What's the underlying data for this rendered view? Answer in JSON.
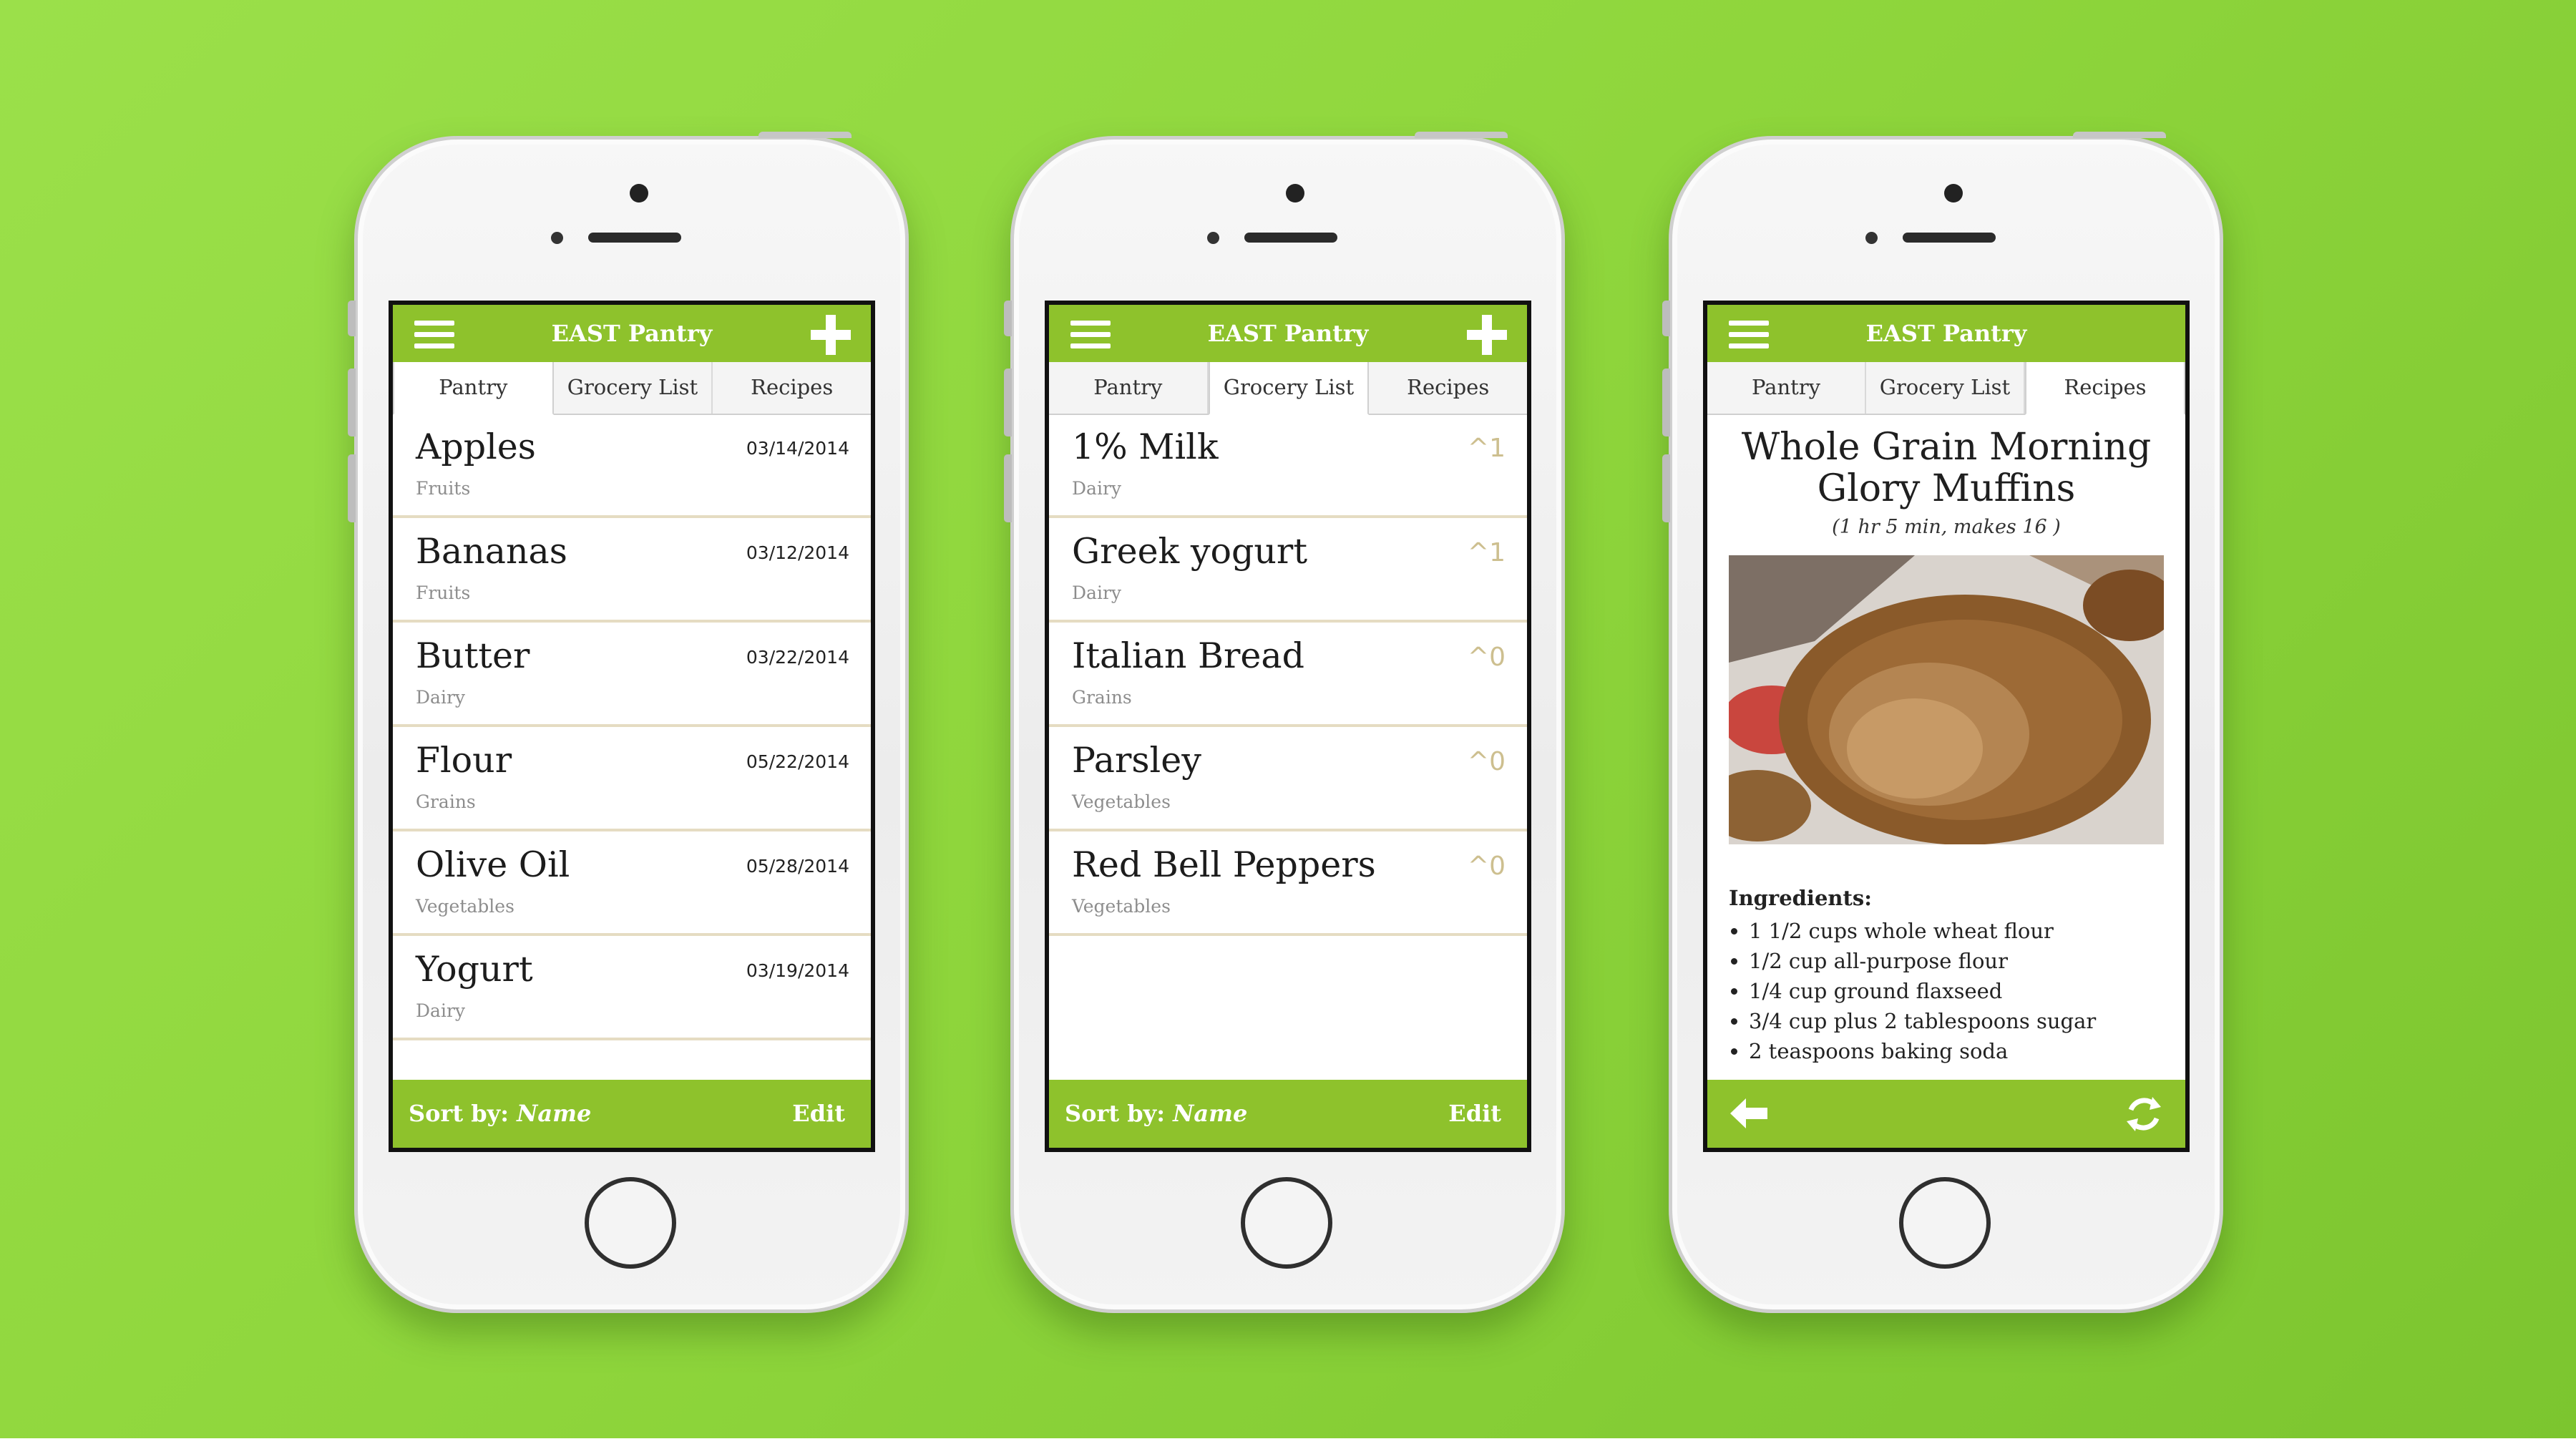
{
  "colors": {
    "background": "#8fd63c",
    "accent": "#8ec22c",
    "divider": "#e5dcc2",
    "vote": "#cdbf8f"
  },
  "app": {
    "title": "EAST Pantry"
  },
  "tabs": [
    "Pantry",
    "Grocery List",
    "Recipes"
  ],
  "footer": {
    "sort_label": "Sort by:",
    "sort_value": "Name",
    "edit": "Edit"
  },
  "pantry_screen": {
    "active_tab": "Pantry",
    "items": [
      {
        "name": "Apples",
        "category": "Fruits",
        "date": "03/14/2014"
      },
      {
        "name": "Bananas",
        "category": "Fruits",
        "date": "03/12/2014"
      },
      {
        "name": "Butter",
        "category": "Dairy",
        "date": "03/22/2014"
      },
      {
        "name": "Flour",
        "category": "Grains",
        "date": "05/22/2014"
      },
      {
        "name": "Olive Oil",
        "category": "Vegetables",
        "date": "05/28/2014"
      },
      {
        "name": "Yogurt",
        "category": "Dairy",
        "date": "03/19/2014"
      }
    ]
  },
  "grocery_screen": {
    "active_tab": "Grocery List",
    "items": [
      {
        "name": "1% Milk",
        "category": "Dairy",
        "votes": "1"
      },
      {
        "name": "Greek yogurt",
        "category": "Dairy",
        "votes": "1"
      },
      {
        "name": "Italian Bread",
        "category": "Grains",
        "votes": "0"
      },
      {
        "name": "Parsley",
        "category": "Vegetables",
        "votes": "0"
      },
      {
        "name": "Red Bell Peppers",
        "category": "Vegetables",
        "votes": "0"
      }
    ]
  },
  "recipe_screen": {
    "active_tab": "Recipes",
    "title_line1": "Whole Grain Morning",
    "title_line2": "Glory Muffins",
    "meta": "(1 hr 5 min, makes 16 )",
    "ingredients_header": "Ingredients:",
    "ingredients": [
      "1 1/2 cups whole wheat flour",
      "1/2 cup all-purpose flour",
      "1/4 cup ground flaxseed",
      "3/4 cup plus 2 tablespoons sugar",
      "2 teaspoons baking soda"
    ]
  },
  "icons": [
    "hamburger-icon",
    "plus-icon",
    "vote-up-icon",
    "back-arrow-icon",
    "refresh-icon"
  ]
}
